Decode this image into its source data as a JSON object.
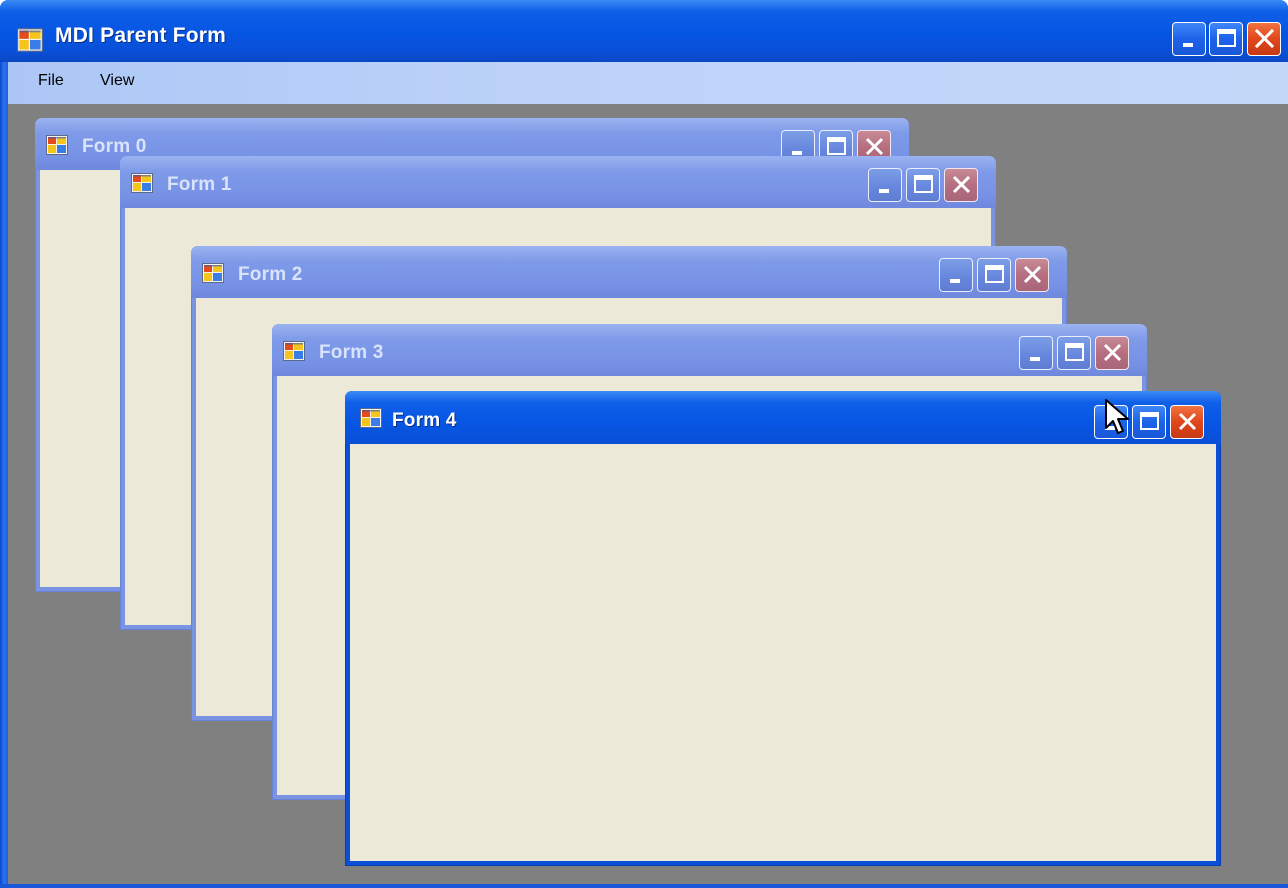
{
  "app": {
    "title": "MDI Parent Form",
    "icon": "form-icon"
  },
  "menu": {
    "items": [
      {
        "label": "File"
      },
      {
        "label": "View"
      }
    ]
  },
  "children": [
    {
      "title": "Form 0",
      "active": false
    },
    {
      "title": "Form 1",
      "active": false
    },
    {
      "title": "Form 2",
      "active": false
    },
    {
      "title": "Form 3",
      "active": false
    },
    {
      "title": "Form 4",
      "active": true
    }
  ],
  "caption_buttons": [
    "minimize-icon",
    "maximize-icon",
    "close-icon"
  ],
  "colors": {
    "titlebar_active": "#0555e3",
    "titlebar_inactive": "#7b93e3",
    "mdi_background": "#808080",
    "client_background": "#ece9d8",
    "close_active": "#e1461c"
  }
}
